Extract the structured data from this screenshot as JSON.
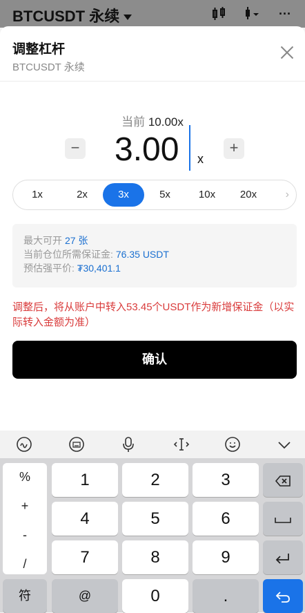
{
  "topbar": {
    "title": "BTCUSDT 永续",
    "icons": [
      "candlestick-icon",
      "indicator-icon",
      "more-icon"
    ]
  },
  "dialog": {
    "title": "调整杠杆",
    "subtitle": "BTCUSDT 永续"
  },
  "leverage": {
    "current_label": "当前",
    "current_value": "10.00x",
    "value": "3.00",
    "unit": "x",
    "minus": "−",
    "plus": "+"
  },
  "presets": {
    "items": [
      "1x",
      "2x",
      "3x",
      "5x",
      "10x",
      "20x"
    ],
    "selected": "3x"
  },
  "info": {
    "max_label": "最大可开",
    "max_value": "27 张",
    "margin_label": "当前仓位所需保证金:",
    "margin_value": "76.35 USDT",
    "liq_label": "预估强平价:",
    "liq_value": "₮30,401.1"
  },
  "warning": "调整后，将从账户中转入53.45个USDT作为新增保证金（以实际转入金额为准）",
  "confirm_label": "确认",
  "keyboard": {
    "tools": [
      "handwriting-icon",
      "keyboard-icon",
      "microphone-icon",
      "cursor-move-icon",
      "emoji-icon",
      "collapse-chevron-icon"
    ],
    "side": [
      "%",
      "+",
      "-",
      "/"
    ],
    "digits": [
      "1",
      "2",
      "3",
      "4",
      "5",
      "6",
      "7",
      "8",
      "9"
    ],
    "bottom": {
      "symbol": "符",
      "at": "@",
      "zero": "0",
      "dot": "."
    }
  },
  "colors": {
    "accent": "#1a73e8",
    "warning": "#d93b3b",
    "confirm_bg": "#000000"
  }
}
